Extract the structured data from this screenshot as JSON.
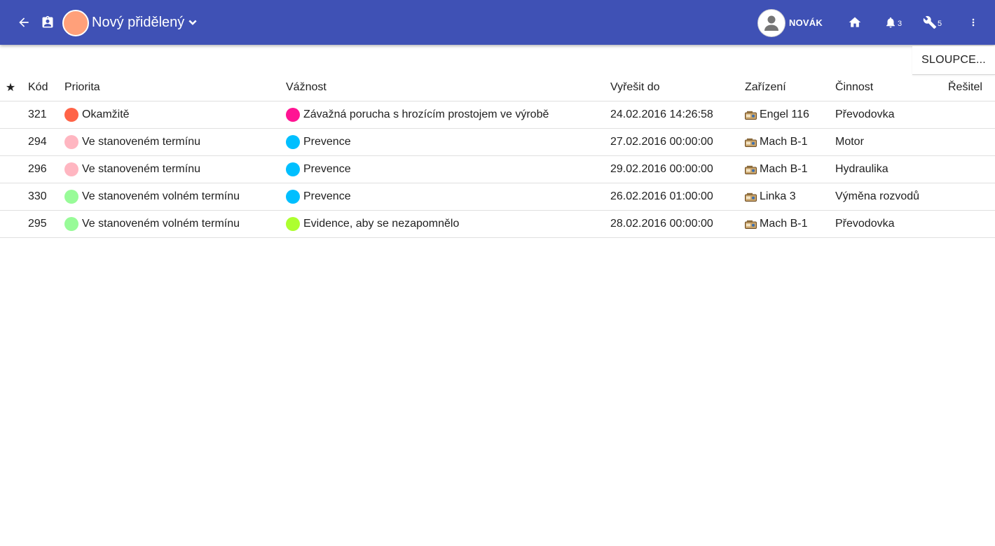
{
  "header": {
    "title": "Nový přidělený",
    "status_color": "#ffa07a",
    "user_name": "NOVÁK",
    "notifications_count": "3",
    "tools_count": "5",
    "bar_color": "#3f51b5"
  },
  "toolbar": {
    "columns_label": "SLOUPCE..."
  },
  "table": {
    "columns": {
      "star": "★",
      "code": "Kód",
      "priority": "Priorita",
      "severity": "Vážnost",
      "due": "Vyřešit do",
      "device": "Zařízení",
      "activity": "Činnost",
      "solver": "Řešitel"
    },
    "rows": [
      {
        "code": "321",
        "priority": "Okamžitě",
        "priority_color": "#ff6347",
        "severity": "Závažná porucha s hrozícím prostojem ve výrobě",
        "severity_color": "#ff1493",
        "due": "24.02.2016 14:26:58",
        "device": "Engel 116",
        "activity": "Převodovka",
        "solver": ""
      },
      {
        "code": "294",
        "priority": "Ve stanoveném termínu",
        "priority_color": "#ffb6c1",
        "severity": "Prevence",
        "severity_color": "#00bfff",
        "due": "27.02.2016 00:00:00",
        "device": "Mach B-1",
        "activity": "Motor",
        "solver": ""
      },
      {
        "code": "296",
        "priority": "Ve stanoveném termínu",
        "priority_color": "#ffb6c1",
        "severity": "Prevence",
        "severity_color": "#00bfff",
        "due": "29.02.2016 00:00:00",
        "device": "Mach B-1",
        "activity": "Hydraulika",
        "solver": ""
      },
      {
        "code": "330",
        "priority": "Ve stanoveném volném termínu",
        "priority_color": "#98fb98",
        "severity": "Prevence",
        "severity_color": "#00bfff",
        "due": "26.02.2016 01:00:00",
        "device": "Linka 3",
        "activity": "Výměna rozvodů",
        "solver": ""
      },
      {
        "code": "295",
        "priority": "Ve stanoveném volném termínu",
        "priority_color": "#98fb98",
        "severity": "Evidence, aby se nezapomnělo",
        "severity_color": "#adff2f",
        "due": "28.02.2016 00:00:00",
        "device": "Mach B-1",
        "activity": "Převodovka",
        "solver": ""
      }
    ]
  }
}
